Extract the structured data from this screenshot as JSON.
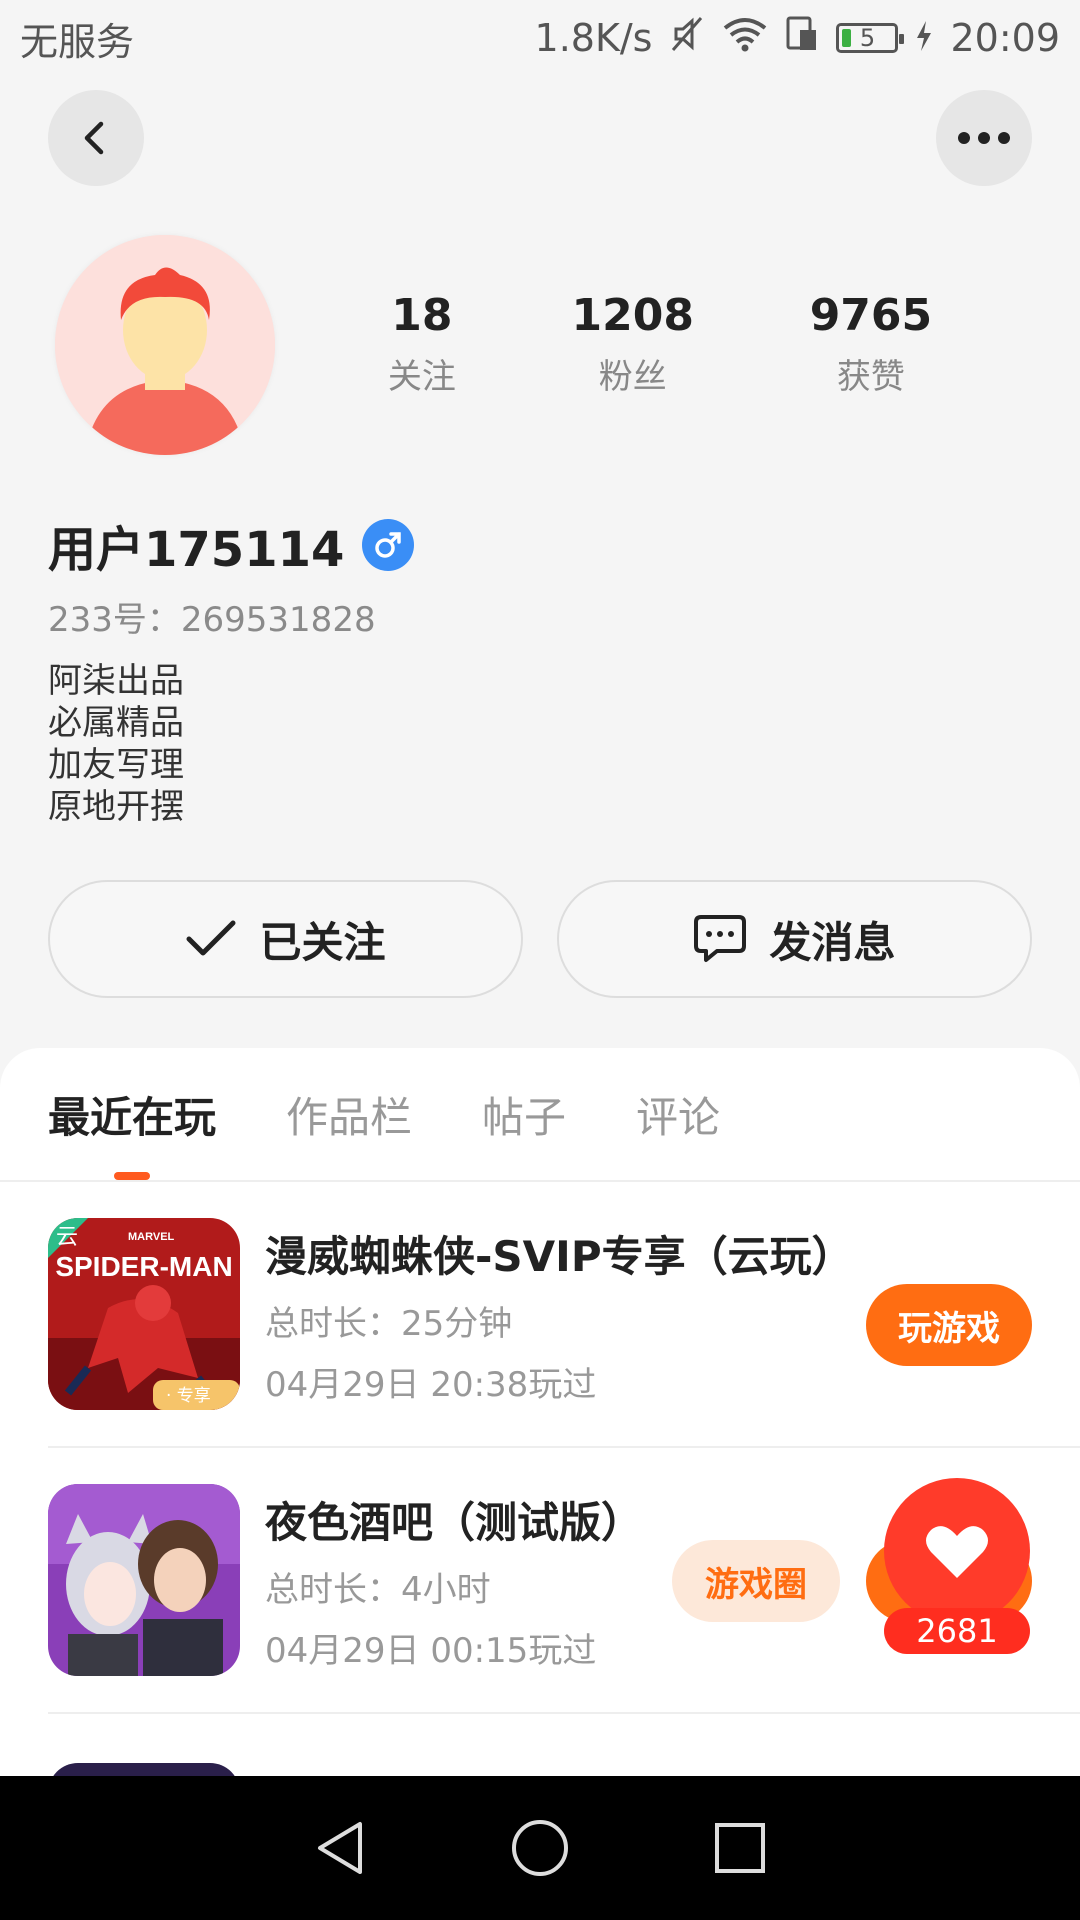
{
  "status_bar": {
    "carrier": "无服务",
    "net_speed": "1.8K/s",
    "battery_level": "5",
    "time": "20:09"
  },
  "profile": {
    "stats": [
      {
        "value": "18",
        "label": "关注"
      },
      {
        "value": "1208",
        "label": "粉丝"
      },
      {
        "value": "9765",
        "label": "获赞"
      }
    ],
    "username": "用户175114",
    "uid": "233号：269531828",
    "bio": [
      "阿柒出品",
      "必属精品",
      "加友写理",
      "原地开摆"
    ],
    "follow_label": "已关注",
    "message_label": "发消息"
  },
  "tabs": [
    "最近在玩",
    "作品栏",
    "帖子",
    "评论"
  ],
  "games": [
    {
      "title": "漫威蜘蛛侠-SVIP专享（云玩）",
      "duration": "总时长：25分钟",
      "last_played": "04月29日 20:38玩过",
      "action": "玩游戏",
      "icon_badge": "云",
      "icon_text": "SPIDER-MAN",
      "icon_brand": "MARVEL",
      "icon_corner": "· 专享"
    },
    {
      "title": "夜色酒吧（测试版）",
      "duration": "总时长：4小时",
      "last_played": "04月29日 00:15玩过",
      "tag": "游戏圈",
      "likes": "2681"
    }
  ],
  "colors": {
    "accent": "#ff6d12",
    "like": "#ff3b2a",
    "gender": "#3a8ef6"
  }
}
